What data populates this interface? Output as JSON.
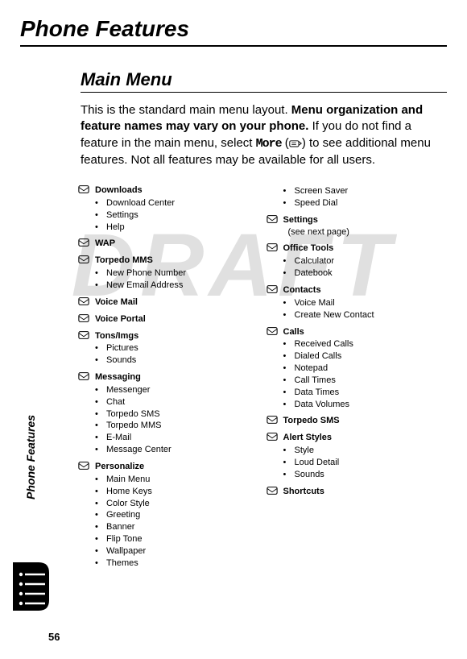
{
  "watermark": "DRAFT",
  "chapter_title": "Phone Features",
  "section_title": "Main Menu",
  "intro": {
    "p1": "This is the standard main menu layout. ",
    "bold": "Menu organization and feature names may vary on your phone.",
    "p2": " If you do not find a feature in the main menu, select ",
    "more_label": "More",
    "p3": " (",
    "p4": ") to see additional menu features. Not all features may be available for all users."
  },
  "side_tab": "Phone Features",
  "page_number": "56",
  "left_col": [
    {
      "title": "Downloads",
      "items": [
        "Download Center",
        "Settings",
        "Help"
      ]
    },
    {
      "title": "WAP",
      "items": []
    },
    {
      "title": "Torpedo MMS",
      "items": [
        "New Phone Number",
        "New Email Address"
      ]
    },
    {
      "title": "Voice Mail",
      "items": []
    },
    {
      "title": "Voice Portal",
      "items": []
    },
    {
      "title": "Tons/Imgs",
      "items": [
        "Pictures",
        "Sounds"
      ]
    },
    {
      "title": "Messaging",
      "items": [
        "Messenger",
        "Chat",
        "Torpedo SMS",
        "Torpedo MMS",
        "E-Mail",
        "Message Center"
      ]
    },
    {
      "title": "Personalize",
      "items": [
        "Main Menu",
        "Home Keys",
        "Color Style",
        "Greeting",
        "Banner",
        "Flip Tone",
        "Wallpaper",
        "Themes"
      ]
    }
  ],
  "right_prelude_items": [
    "Screen Saver",
    "Speed Dial"
  ],
  "right_col": [
    {
      "title": "Settings",
      "note": "(see next page)",
      "items": []
    },
    {
      "title": "Office Tools",
      "items": [
        "Calculator",
        "Datebook"
      ]
    },
    {
      "title": "Contacts",
      "items": [
        "Voice Mail",
        "Create New Contact"
      ]
    },
    {
      "title": "Calls",
      "items": [
        "Received Calls",
        "Dialed Calls",
        "Notepad",
        "Call Times",
        "Data Times",
        "Data Volumes"
      ]
    },
    {
      "title": "Torpedo SMS",
      "items": []
    },
    {
      "title": "Alert Styles",
      "items": [
        "Style",
        "Loud Detail",
        "Sounds"
      ]
    },
    {
      "title": "Shortcuts",
      "items": []
    }
  ]
}
